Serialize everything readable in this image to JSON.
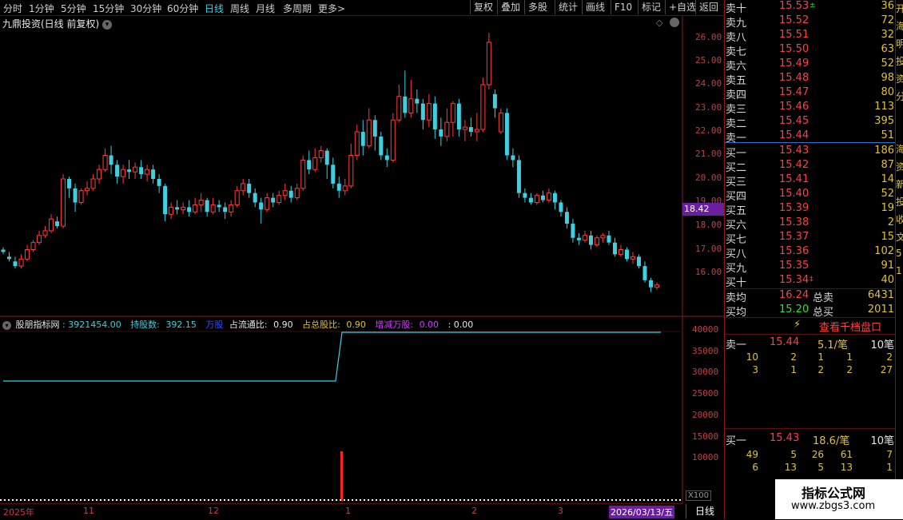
{
  "toolbar": {
    "periods": [
      "分时",
      "1分钟",
      "5分钟",
      "15分钟",
      "30分钟",
      "60分钟",
      "日线",
      "周线",
      "月线",
      "多周期",
      "更多"
    ],
    "active_period": "日线",
    "more_arrow": ">",
    "buttons": [
      "复权",
      "叠加",
      "多股",
      "统计",
      "画线",
      "F10",
      "标记",
      "+自选",
      "返回"
    ]
  },
  "stock_title": "九鼎投资(日线 前复权)",
  "colors": {
    "up": "#ff3c3c",
    "down": "#3ecfe0",
    "accent": "#6b1fa0",
    "yellow": "#e0c040",
    "green": "#30e030"
  },
  "price_axis": {
    "labels": [
      "26.00",
      "25.00",
      "24.00",
      "23.00",
      "22.00",
      "21.00",
      "20.00",
      "19.00",
      "18.00",
      "17.00",
      "16.00"
    ]
  },
  "current_price_tag": "18.42",
  "indicator": {
    "name": "股朋指标网",
    "v1": "3921454.00",
    "hold_label": "持股数:",
    "hold_value": "392.15",
    "unit": "万股",
    "float_label": "占流通比:",
    "float_value": "0.90",
    "total_label": "占总股比:",
    "total_value": "0.90",
    "change_label": "增减万股:",
    "change_value": "0.00",
    "extra": ": 0.00",
    "axis": [
      "40000",
      "35000",
      "30000",
      "25000",
      "20000",
      "15000",
      "10000"
    ],
    "scale_tag": "X100"
  },
  "dates": [
    "2025年",
    "11",
    "12",
    "1",
    "2",
    "3"
  ],
  "date_highlight": "2026/03/13/五",
  "day_tab": "日线",
  "order_book": {
    "sell": [
      {
        "label": "卖十",
        "price": "15.53",
        "vol": "36",
        "mark": "±"
      },
      {
        "label": "卖九",
        "price": "15.52",
        "vol": "72"
      },
      {
        "label": "卖八",
        "price": "15.51",
        "vol": "32"
      },
      {
        "label": "卖七",
        "price": "15.50",
        "vol": "63"
      },
      {
        "label": "卖六",
        "price": "15.49",
        "vol": "52"
      },
      {
        "label": "卖五",
        "price": "15.48",
        "vol": "98"
      },
      {
        "label": "卖四",
        "price": "15.47",
        "vol": "80"
      },
      {
        "label": "卖三",
        "price": "15.46",
        "vol": "113"
      },
      {
        "label": "卖二",
        "price": "15.45",
        "vol": "395"
      },
      {
        "label": "卖一",
        "price": "15.44",
        "vol": "51"
      }
    ],
    "buy": [
      {
        "label": "买一",
        "price": "15.43",
        "vol": "186"
      },
      {
        "label": "买二",
        "price": "15.42",
        "vol": "87"
      },
      {
        "label": "买三",
        "price": "15.41",
        "vol": "14"
      },
      {
        "label": "买四",
        "price": "15.40",
        "vol": "52"
      },
      {
        "label": "买五",
        "price": "15.39",
        "vol": "19"
      },
      {
        "label": "买六",
        "price": "15.38",
        "vol": "2"
      },
      {
        "label": "买七",
        "price": "15.37",
        "vol": "15"
      },
      {
        "label": "买八",
        "price": "15.36",
        "vol": "102"
      },
      {
        "label": "买九",
        "price": "15.35",
        "vol": "91"
      },
      {
        "label": "买十",
        "price": "15.34",
        "vol": "40",
        "mark": "‡"
      }
    ],
    "avg_sell_label": "卖均",
    "avg_sell": "16.24",
    "total_sell_label": "总卖",
    "total_sell": "6431",
    "avg_buy_label": "买均",
    "avg_buy": "15.20",
    "total_buy_label": "总买",
    "total_buy": "2011"
  },
  "queue": {
    "link_label": "查看千档盘口",
    "sell1": {
      "label": "卖一",
      "price": "15.44",
      "per": "5.1/笔",
      "count": "10笔",
      "rows": [
        [
          "10",
          "2",
          "1",
          "1",
          "2"
        ],
        [
          "3",
          "1",
          "2",
          "2",
          "27"
        ]
      ]
    },
    "buy1": {
      "label": "买一",
      "price": "15.43",
      "per": "18.6/笔",
      "count": "10笔",
      "rows": [
        [
          "49",
          "5",
          "26",
          "61",
          "7"
        ],
        [
          "6",
          "13",
          "5",
          "13",
          "1"
        ]
      ]
    }
  },
  "right_edge_chars": [
    "开",
    "海",
    "明",
    "投",
    "资",
    "分",
    "",
    "",
    "海",
    "资",
    "新",
    "投",
    "收",
    "文",
    "5",
    "1"
  ],
  "watermark": {
    "title": "指标公式网",
    "url": "www.zbgs3.com"
  }
}
